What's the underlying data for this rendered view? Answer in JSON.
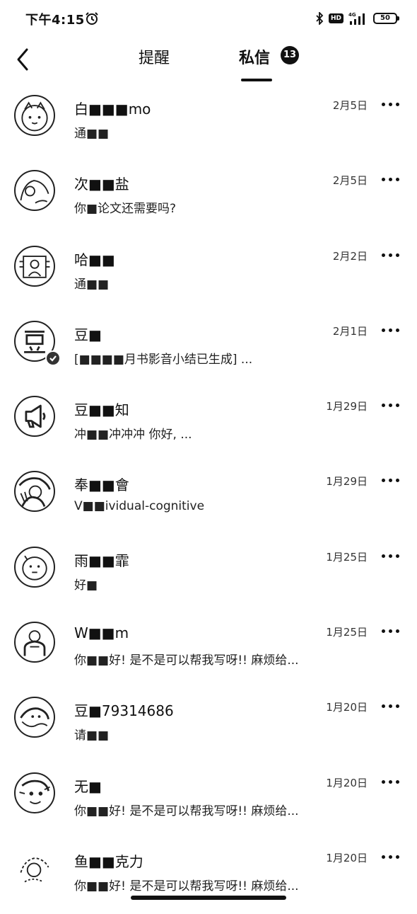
{
  "status_bar": {
    "time": "下午4:15",
    "network": "4G",
    "battery": "50"
  },
  "header": {
    "tabs": [
      {
        "label": "提醒"
      },
      {
        "label": "私信",
        "badge": "13"
      }
    ]
  },
  "messages": [
    {
      "name": "白■■■mo",
      "preview": "通■■",
      "date": "2月5日"
    },
    {
      "name": "次■■盐",
      "preview": "你■论文还需要吗?",
      "date": "2月5日"
    },
    {
      "name": "哈■■",
      "preview": "通■■",
      "date": "2月2日"
    },
    {
      "name": "豆■",
      "preview": "[■■■■月书影音小结已生成] ...",
      "date": "2月1日"
    },
    {
      "name": "豆■■知",
      "preview": "冲■■冲冲冲 你好, ...",
      "date": "1月29日"
    },
    {
      "name": "奉■■會",
      "preview": "V■■ividual-cognitive",
      "date": "1月29日"
    },
    {
      "name": "雨■■霏",
      "preview": "好■",
      "date": "1月25日"
    },
    {
      "name": "W■■m",
      "preview": "你■■好! 是不是可以帮我写呀!! 麻烦给...",
      "date": "1月25日"
    },
    {
      "name": "豆■79314686",
      "preview": "请■■",
      "date": "1月20日"
    },
    {
      "name": "无■",
      "preview": "你■■好! 是不是可以帮我写呀!! 麻烦给...",
      "date": "1月20日"
    },
    {
      "name": "鱼■■克力",
      "preview": "你■■好! 是不是可以帮我写呀!! 麻烦给...",
      "date": "1月20日"
    }
  ]
}
